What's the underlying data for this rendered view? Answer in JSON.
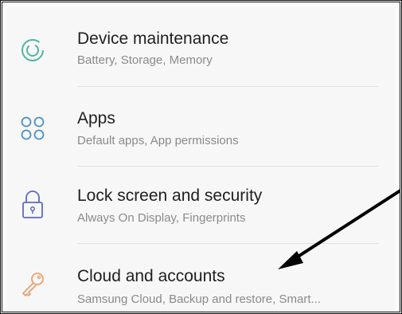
{
  "settings": {
    "items": [
      {
        "title": "Device maintenance",
        "subtitle": "Battery, Storage, Memory",
        "icon": "device-maintenance-icon",
        "icon_color": "#4db6a0"
      },
      {
        "title": "Apps",
        "subtitle": "Default apps, App permissions",
        "icon": "apps-grid-icon",
        "icon_color": "#4a90c8"
      },
      {
        "title": "Lock screen and security",
        "subtitle": "Always On Display, Fingerprints",
        "icon": "lock-icon",
        "icon_color": "#5c6bc0"
      },
      {
        "title": "Cloud and accounts",
        "subtitle": "Samsung Cloud, Backup and restore, Smart...",
        "icon": "key-icon",
        "icon_color": "#e8a070"
      }
    ]
  },
  "annotation": {
    "arrow_color": "#000000",
    "arrow_target": "Cloud and accounts"
  }
}
